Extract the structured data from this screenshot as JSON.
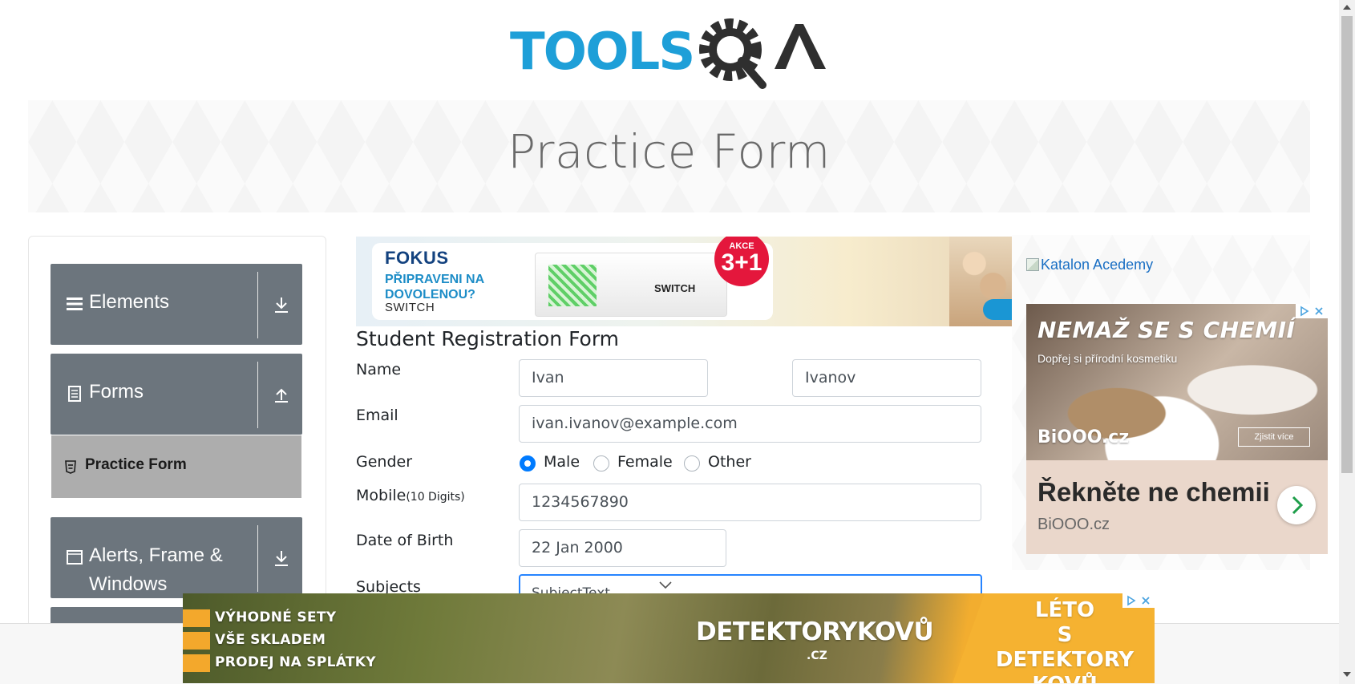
{
  "header": {
    "logo_text": "TOOLSQA",
    "banner_title": "Practice Form"
  },
  "sidebar": {
    "groups": [
      {
        "label": "Elements",
        "icon": "hamburger-icon",
        "arrow": "download-arrow-icon"
      },
      {
        "label": "Forms",
        "icon": "document-icon",
        "arrow": "upload-arrow-icon"
      },
      {
        "label": "Alerts, Frame & Windows",
        "icon": "window-icon",
        "arrow": "download-arrow-icon"
      }
    ],
    "active_item": {
      "label": "Practice Form",
      "icon": "html5-icon"
    }
  },
  "top_ad": {
    "brand": "FOKUS",
    "line1": "PŘIPRAVENI NA",
    "line2": "DOVOLENOU?",
    "line3": "SWITCH",
    "product_text": "SWITCH",
    "badge_top": "AKCE",
    "badge_main": "3+1"
  },
  "form": {
    "title": "Student Registration Form",
    "name_label": "Name",
    "first_name": "Ivan",
    "last_name": "Ivanov",
    "email_label": "Email",
    "email": "ivan.ivanov@example.com",
    "gender_label": "Gender",
    "gender_options": [
      {
        "label": "Male",
        "checked": true
      },
      {
        "label": "Female",
        "checked": false
      },
      {
        "label": "Other",
        "checked": false
      }
    ],
    "mobile_label": "Mobile",
    "mobile_hint": "(10 Digits)",
    "mobile": "1234567890",
    "dob_label": "Date of Birth",
    "dob": "22 Jan 2000",
    "subjects_label": "Subjects",
    "subjects_value": "SubjectText"
  },
  "right_ads": {
    "katalon_alt": "Katalon Acedemy",
    "headline": "NEMAŽ SE S CHEMIÍ",
    "sub": "Dopřej si přírodní kosmetiku",
    "logo": "BiOOO.cz",
    "button": "Zjistit více",
    "tagline": "Řekněte ne chemii",
    "domain": "BiOOO.cz"
  },
  "bottom_ad": {
    "bullets": [
      "VÝHODNÉ SETY",
      "VŠE SKLADEM",
      "PRODEJ NA SPLÁTKY"
    ],
    "logo": "DETEKTORYKOVŮ",
    "logo_sub": ".CZ",
    "right_text": [
      "LÉTO",
      "S DETEKTORY",
      "KOVŮ"
    ]
  },
  "colors": {
    "accent": "#007bff",
    "sidebar_header": "#6c757d",
    "active_item": "#adadad",
    "logo_blue": "#1e9fd8",
    "logo_dark": "#2f2f2f"
  }
}
